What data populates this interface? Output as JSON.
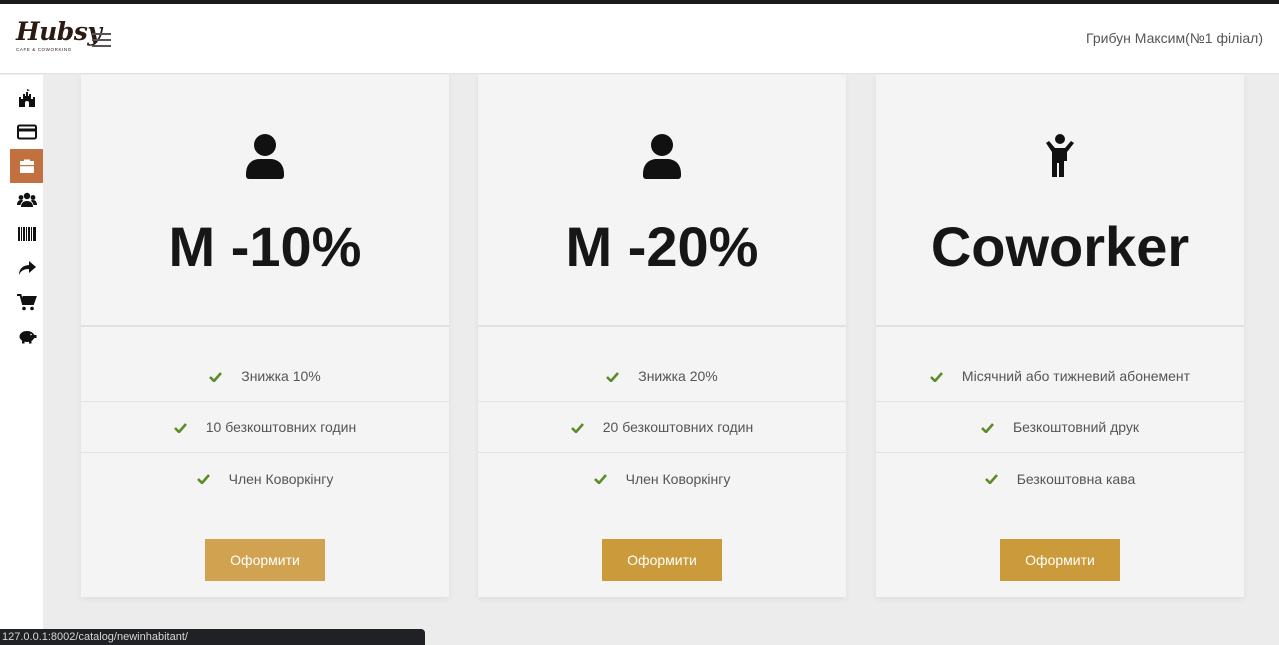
{
  "header": {
    "logo_text": "Hubsy",
    "logo_subtitle": "CAFE & COWORKING",
    "user": "Грибун Максим(№1 філіал)"
  },
  "sidebar": {
    "items": [
      {
        "icon": "castle-icon"
      },
      {
        "icon": "credit-card-icon"
      },
      {
        "icon": "briefcase-icon",
        "active": true
      },
      {
        "icon": "users-icon"
      },
      {
        "icon": "barcode-icon"
      },
      {
        "icon": "share-arrow-icon"
      },
      {
        "icon": "cart-icon"
      },
      {
        "icon": "piggy-bank-icon"
      }
    ]
  },
  "plans": [
    {
      "icon": "user-icon",
      "title": "M -10%",
      "features": [
        "Знижка 10%",
        "10 безкоштовних годин",
        "Член Коворкінгу"
      ],
      "button": "Оформити"
    },
    {
      "icon": "user-icon",
      "title": "M -20%",
      "features": [
        "Знижка 20%",
        "20 безкоштовних годин",
        "Член Коворкінгу"
      ],
      "button": "Оформити"
    },
    {
      "icon": "child-icon",
      "title": "Coworker",
      "features": [
        "Місячний або тижневий абонемент",
        "Безкоштовний друк",
        "Безкоштовна кава"
      ],
      "button": "Оформити"
    }
  ],
  "status_url": "127.0.0.1:8002/catalog/newinhabitant/",
  "colors": {
    "accent_button": "#cb9a3a",
    "active_sidebar": "#c2703f",
    "check": "#5b8c2a"
  }
}
